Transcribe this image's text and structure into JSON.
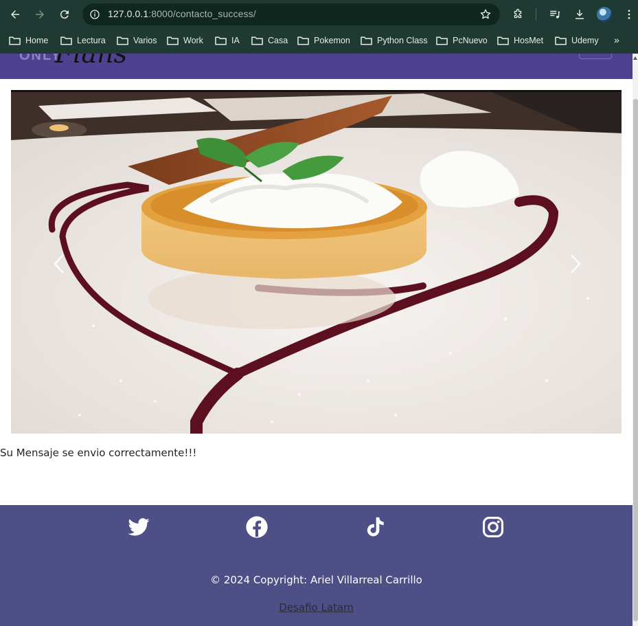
{
  "browser": {
    "url_host": "127.0.0.1",
    "url_rest": ":8000/contacto_success/",
    "bookmarks": [
      {
        "label": "Home"
      },
      {
        "label": "Lectura"
      },
      {
        "label": "Varios"
      },
      {
        "label": "Work"
      },
      {
        "label": "IA"
      },
      {
        "label": "Casa"
      },
      {
        "label": "Pokemon"
      },
      {
        "label": "Python Class"
      },
      {
        "label": "PcNuevo"
      },
      {
        "label": "HosMet"
      },
      {
        "label": "Udemy"
      }
    ],
    "more_label": "»"
  },
  "navbar": {
    "logo_prefix": "ONLY",
    "logo_script": "Flans"
  },
  "main": {
    "message": "Su Mensaje se envio correctamente!!!"
  },
  "footer": {
    "social": [
      "twitter-icon",
      "facebook-icon",
      "tiktok-icon",
      "instagram-icon"
    ],
    "copyright": "© 2024 Copyright: Ariel Villarreal Carrillo",
    "link_label": "Desafio Latam"
  },
  "colors": {
    "chrome_bg": "#1f3a32",
    "navbar_bg": "#4e4290",
    "footer_bg": "#4f4f87"
  }
}
